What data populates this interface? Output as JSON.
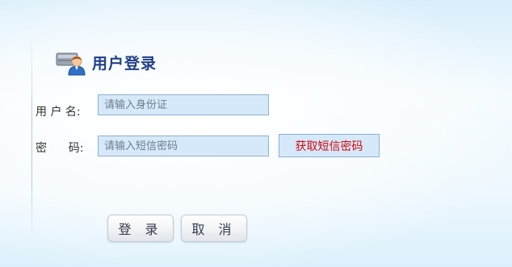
{
  "login": {
    "title": "用户登录",
    "username_label": "用 户 名:",
    "username_placeholder": "请输入身份证",
    "username_value": "",
    "password_label": "密      码:",
    "password_placeholder": "请输入短信密码",
    "password_value": "",
    "get_sms_label": "获取短信密码",
    "login_label": "登 录",
    "cancel_label": "取 消"
  },
  "icons": {
    "title_icon": "user-icon"
  },
  "colors": {
    "title": "#1f3f86",
    "sms_text": "#d20a0a",
    "field_bg": "#d6e9fb",
    "field_border": "#8fb0d0"
  }
}
